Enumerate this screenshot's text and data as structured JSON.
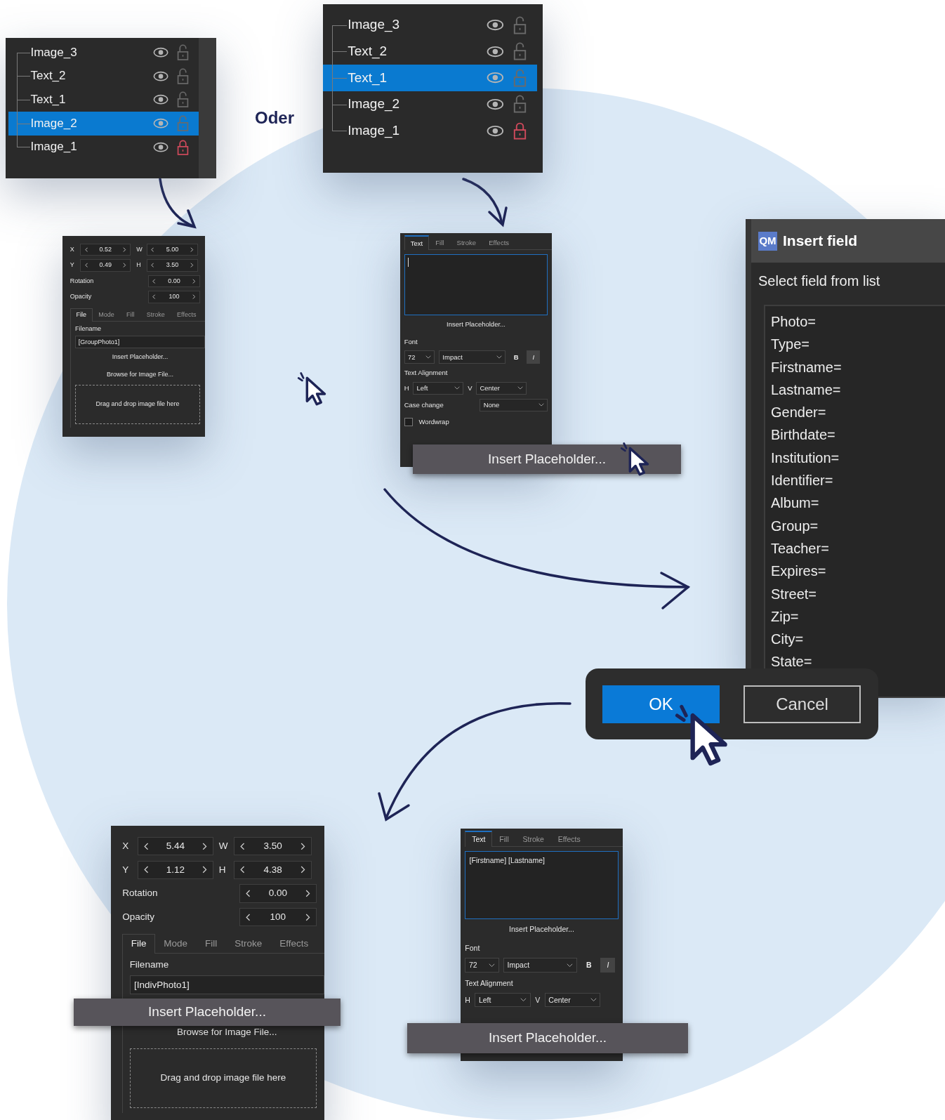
{
  "layer_panels": [
    {
      "layers": [
        {
          "name": "Image_3",
          "selected": false,
          "locked": false
        },
        {
          "name": "Text_2",
          "selected": false,
          "locked": false
        },
        {
          "name": "Text_1",
          "selected": false,
          "locked": false
        },
        {
          "name": "Image_2",
          "selected": true,
          "locked": false
        },
        {
          "name": "Image_1",
          "selected": false,
          "locked": true
        }
      ]
    },
    {
      "layers": [
        {
          "name": "Image_3",
          "selected": false,
          "locked": false
        },
        {
          "name": "Text_2",
          "selected": false,
          "locked": false
        },
        {
          "name": "Text_1",
          "selected": true,
          "locked": false
        },
        {
          "name": "Image_2",
          "selected": false,
          "locked": false
        },
        {
          "name": "Image_1",
          "selected": false,
          "locked": true
        }
      ]
    }
  ],
  "separator_label": "Oder",
  "image_panels": [
    {
      "fields": [
        {
          "label": "X",
          "value": "0.52"
        },
        {
          "label": "W",
          "value": "5.00"
        },
        {
          "label": "Y",
          "value": "0.49"
        },
        {
          "label": "H",
          "value": "3.50"
        }
      ],
      "rows": [
        {
          "label": "Rotation",
          "value": "0.00"
        },
        {
          "label": "Opacity",
          "value": "100"
        }
      ],
      "tabs": [
        {
          "label": "File",
          "selected": true
        },
        {
          "label": "Mode",
          "selected": false
        },
        {
          "label": "Fill",
          "selected": false
        },
        {
          "label": "Stroke",
          "selected": false
        },
        {
          "label": "Effects",
          "selected": false
        }
      ],
      "filename_label": "Filename",
      "filename": "[GroupPhoto1]",
      "insert_placeholder": "Insert Placeholder...",
      "browse": "Browse for Image File...",
      "drop_hint": "Drag and drop image file here"
    },
    {
      "fields": [
        {
          "label": "X",
          "value": "5.44"
        },
        {
          "label": "W",
          "value": "3.50"
        },
        {
          "label": "Y",
          "value": "1.12"
        },
        {
          "label": "H",
          "value": "4.38"
        }
      ],
      "rows": [
        {
          "label": "Rotation",
          "value": "0.00"
        },
        {
          "label": "Opacity",
          "value": "100"
        }
      ],
      "tabs": [
        {
          "label": "File",
          "selected": true
        },
        {
          "label": "Mode",
          "selected": false
        },
        {
          "label": "Fill",
          "selected": false
        },
        {
          "label": "Stroke",
          "selected": false
        },
        {
          "label": "Effects",
          "selected": false
        }
      ],
      "filename_label": "Filename",
      "filename": "[IndivPhoto1]",
      "browse": "Browse for Image File...",
      "drop_hint": "Drag and drop image file here",
      "overlay_button": "Insert Placeholder..."
    }
  ],
  "text_panels": [
    {
      "tabs": [
        {
          "label": "Text",
          "selected": true
        },
        {
          "label": "Fill",
          "selected": false
        },
        {
          "label": "Stroke",
          "selected": false
        },
        {
          "label": "Effects",
          "selected": false
        }
      ],
      "insert_placeholder": "Insert Placeholder...",
      "font_label": "Font",
      "size": "72",
      "font": "Impact",
      "bold": "B",
      "italic": "I",
      "align_label": "Text Alignment",
      "h_label": "H",
      "h_value": "Left",
      "v_label": "V",
      "v_value": "Center",
      "case_label": "Case change",
      "case_value": "None",
      "wordwrap": {
        "label": "Wordwrap",
        "checked": false
      },
      "overlay_button": "Insert Placeholder..."
    },
    {
      "tabs": [
        {
          "label": "Text",
          "selected": true
        },
        {
          "label": "Fill",
          "selected": false
        },
        {
          "label": "Stroke",
          "selected": false
        },
        {
          "label": "Effects",
          "selected": false
        }
      ],
      "text": "[Firstname] [Lastname]",
      "insert_placeholder": "Insert Placeholder...",
      "font_label": "Font",
      "size": "72",
      "font": "Impact",
      "bold": "B",
      "italic": "I",
      "align_label": "Text Alignment",
      "h_label": "H",
      "h_value": "Left",
      "v_label": "V",
      "v_value": "Center",
      "overlay_button": "Insert Placeholder..."
    }
  ],
  "insert_field_dialog": {
    "logo": "QM",
    "title": "Insert field",
    "prompt": "Select field from list",
    "fields": [
      "Photo=",
      "Type=",
      "Firstname=",
      "Lastname=",
      "Gender=",
      "Birthdate=",
      "Institution=",
      "Identifier=",
      "Album=",
      "Group=",
      "Teacher=",
      "Expires=",
      "Street=",
      "Zip=",
      "City=",
      "State="
    ]
  },
  "dialog_buttons": [
    {
      "label": "OK",
      "default": true
    },
    {
      "label": "Cancel",
      "default": false
    }
  ]
}
